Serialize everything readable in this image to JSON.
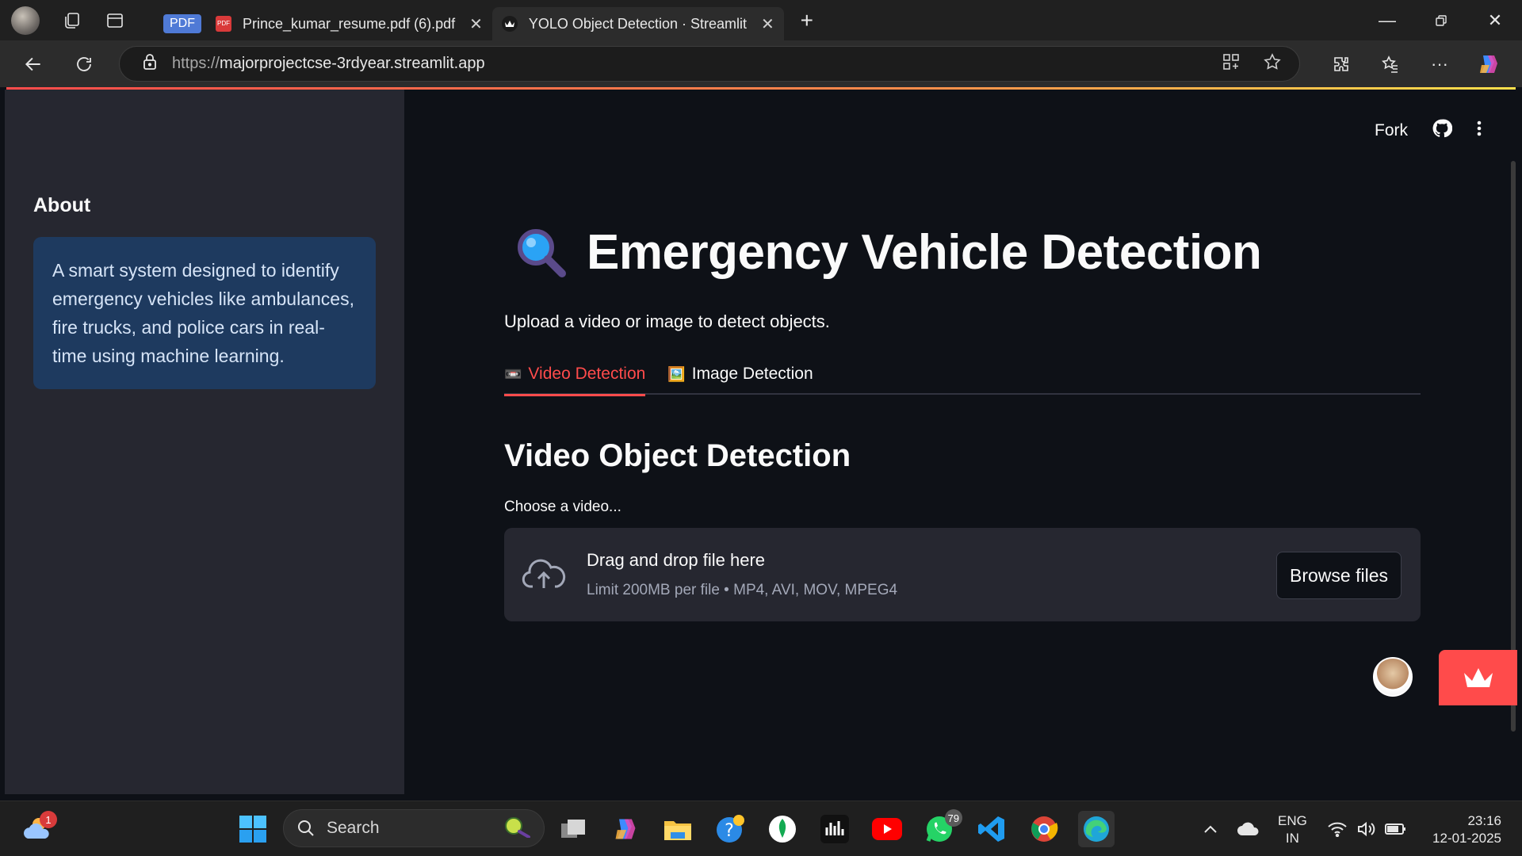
{
  "browser": {
    "tabs": [
      {
        "label": "PDF",
        "type": "pdf-pill"
      },
      {
        "label": "Prince_kumar_resume.pdf (6).pdf",
        "active": false
      },
      {
        "label": "YOLO Object Detection · Streamlit",
        "active": true
      }
    ],
    "url_protocol": "https://",
    "url_host": "majorprojectcse-3rdyear.streamlit.app"
  },
  "sidebar": {
    "heading": "About",
    "info_text": "A smart system designed to identify emergency vehicles like ambulances, fire trucks, and police cars in real-time using machine learning."
  },
  "header": {
    "fork_label": "Fork"
  },
  "main": {
    "title_emoji": "🔍",
    "title": "Emergency Vehicle Detection",
    "subtitle": "Upload a video or image to detect objects.",
    "tabs": [
      {
        "icon": "📼",
        "label": "Video Detection",
        "active": true
      },
      {
        "icon": "🖼️",
        "label": "Image Detection",
        "active": false
      }
    ],
    "section_title": "Video Object Detection",
    "uploader": {
      "label": "Choose a video...",
      "drop_text": "Drag and drop file here",
      "limit_text": "Limit 200MB per file • MP4, AVI, MOV, MPEG4",
      "button_label": "Browse files"
    }
  },
  "taskbar": {
    "search_placeholder": "Search",
    "weather_badge": "1",
    "whatsapp_badge": "79",
    "lang_line1": "ENG",
    "lang_line2": "IN",
    "time": "23:16",
    "date": "12-01-2025"
  },
  "colors": {
    "accent": "#ff4b4b",
    "sidebar_bg": "#262730",
    "app_bg": "#0e1117",
    "info_bg": "#1e3a5f"
  }
}
